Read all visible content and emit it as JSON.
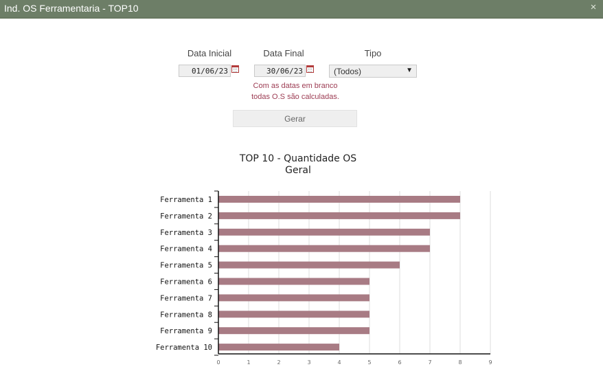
{
  "window": {
    "title": "Ind. OS Ferramentaria - TOP10",
    "close_symbol": "×"
  },
  "filters": {
    "data_inicial_label": "Data Inicial",
    "data_inicial_value": "01/06/23",
    "data_final_label": "Data Final",
    "data_final_value": "30/06/23",
    "tipo_label": "Tipo",
    "tipo_value": "(Todos)",
    "note_line1": "Com as datas em branco",
    "note_line2": "todas O.S são calculadas.",
    "gerar_label": "Gerar"
  },
  "colors": {
    "titlebar": "#6d7e67",
    "bar": "#a87b84",
    "note": "#9c3b52"
  },
  "chart_data": {
    "type": "bar",
    "orientation": "horizontal",
    "title": "TOP 10 - Quantidade OS",
    "subtitle": "Geral",
    "categories": [
      "Ferramenta 1",
      "Ferramenta 2",
      "Ferramenta 3",
      "Ferramenta 4",
      "Ferramenta 5",
      "Ferramenta 6",
      "Ferramenta 7",
      "Ferramenta 8",
      "Ferramenta 9",
      "Ferramenta 10"
    ],
    "values": [
      8,
      8,
      7,
      7,
      6,
      5,
      5,
      5,
      5,
      4
    ],
    "xlim": [
      0,
      9
    ],
    "xticks": [
      0,
      1,
      2,
      3,
      4,
      5,
      6,
      7,
      8,
      9
    ],
    "grid": true,
    "legend": "none"
  }
}
